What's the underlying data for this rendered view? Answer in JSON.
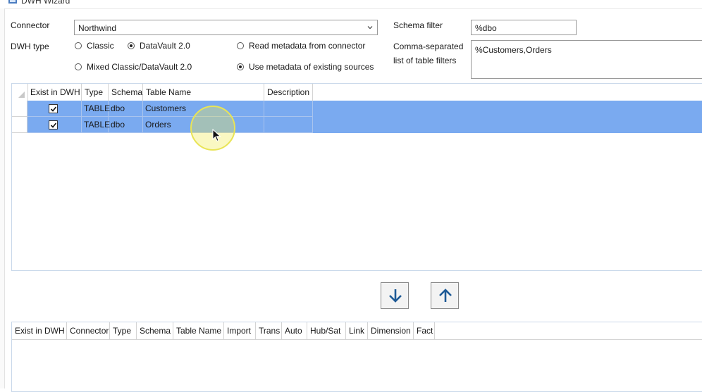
{
  "window": {
    "title": "DWH Wizard"
  },
  "form": {
    "connector_label": "Connector",
    "connector_value": "Northwind",
    "dwh_type_label": "DWH type",
    "dwh_types": [
      {
        "label": "Classic",
        "selected": false
      },
      {
        "label": "DataVault 2.0",
        "selected": true
      },
      {
        "label": "Mixed Classic/DataVault 2.0",
        "selected": false
      }
    ],
    "metadata_options": [
      {
        "label": "Read metadata from connector",
        "selected": false
      },
      {
        "label": "Use metadata of existing sources",
        "selected": true
      }
    ],
    "schema_filter_label": "Schema filter",
    "schema_filter_value": "%dbo",
    "table_filter_label_line1": "Comma-separated",
    "table_filter_label_line2": "list of table filters",
    "table_filter_value": "%Customers,Orders"
  },
  "source_grid": {
    "columns": [
      "Exist in DWH",
      "Type",
      "Schema",
      "Table Name",
      "Description"
    ],
    "rows": [
      {
        "exist": true,
        "type": "TABLE",
        "schema": "dbo",
        "table": "Customers",
        "description": ""
      },
      {
        "exist": true,
        "type": "TABLE",
        "schema": "dbo",
        "table": "Orders",
        "description": ""
      }
    ]
  },
  "transfer": {
    "down_icon": "arrow-down-icon",
    "up_icon": "arrow-up-icon"
  },
  "target_grid": {
    "columns": [
      "Exist in DWH",
      "Connector",
      "Type",
      "Schema",
      "Table Name",
      "Import",
      "Trans",
      "Auto",
      "Hub/Sat",
      "Link",
      "Dimension",
      "Fact"
    ]
  },
  "colors": {
    "selection": "#7aaaf0",
    "grid_border": "#c9d8ea",
    "arrow": "#1e5a96"
  }
}
